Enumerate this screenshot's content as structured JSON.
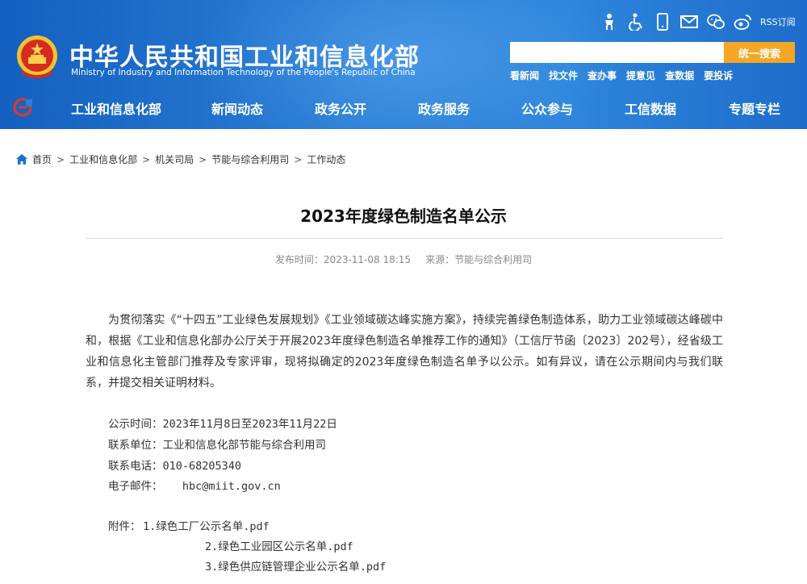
{
  "header": {
    "site_name_cn": "中华人民共和国工业和信息化部",
    "site_name_en": "Ministry of Industry and Information Technology of the People's Republic of China",
    "tools": [
      {
        "icon": "elder-care-icon"
      },
      {
        "icon": "accessibility-icon"
      },
      {
        "icon": "mobile-icon"
      },
      {
        "icon": "mail-icon"
      },
      {
        "icon": "wechat-icon"
      },
      {
        "icon": "weibo-icon"
      }
    ],
    "rss_label": "RSS订阅",
    "search": {
      "placeholder": "",
      "button": "统一搜索"
    },
    "quick_links": [
      "看新闻",
      "找文件",
      "查办事",
      "提意见",
      "查数据",
      "要投诉"
    ]
  },
  "nav": {
    "items": [
      "工业和信息化部",
      "新闻动态",
      "政务公开",
      "政务服务",
      "公众参与",
      "工信数据",
      "专题专栏"
    ]
  },
  "breadcrumb": [
    "首页",
    "工业和信息化部",
    "机关司局",
    "节能与综合利用司",
    "工作动态"
  ],
  "article": {
    "title": "2023年度绿色制造名单公示",
    "publish_time": "发布时间：2023-11-08 18:15",
    "source": "来源：节能与综合利用司",
    "paragraph": "为贯彻落实《“十四五”工业绿色发展规划》《工业领域碳达峰实施方案》，持续完善绿色制造体系，助力工业领域碳达峰碳中和，根据《工业和信息化部办公厅关于开展2023年度绿色制造名单推荐工作的通知》（工信厅节函〔2023〕202号），经省级工业和信息化主管部门推荐及专家评审，现将拟确定的2023年度绿色制造名单予以公示。如有异议，请在公示期间内与我们联系，并提交相关证明材料。",
    "period": "公示时间：2023年11月8日至2023年11月22日",
    "contact_unit": "联系单位：工业和信息化部节能与综合利用司",
    "phone": "联系电话：010-68205340",
    "email": "电子邮件：   hbc@miit.gov.cn",
    "attachments_label": "附件：",
    "attachments": [
      "1.绿色工厂公示名单.pdf",
      "2.绿色工业园区公示名单.pdf",
      "3.绿色供应链管理企业公示名单.pdf"
    ]
  },
  "colors": {
    "header_blue": "#1f6fcf",
    "search_button": "#f5a623",
    "crumb_home": "#1f6fcf"
  }
}
